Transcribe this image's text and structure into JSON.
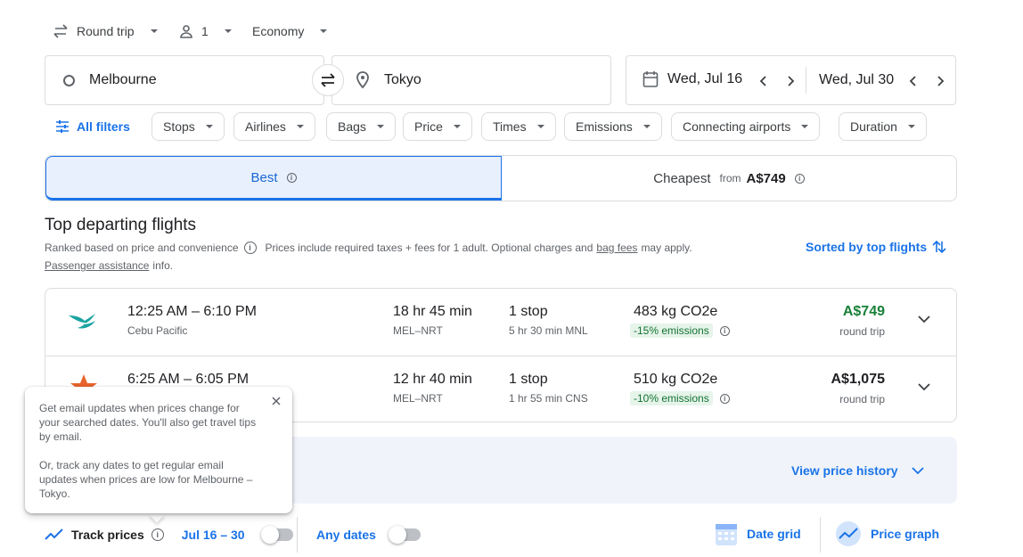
{
  "search": {
    "trip_type": "Round trip",
    "passengers": "1",
    "cabin": "Economy",
    "origin": "Melbourne",
    "destination": "Tokyo",
    "depart_date": "Wed, Jul 16",
    "return_date": "Wed, Jul 30"
  },
  "filters": {
    "all_filters": "All filters",
    "chips": [
      "Stops",
      "Airlines",
      "Bags",
      "Price",
      "Times",
      "Emissions",
      "Connecting airports",
      "Duration"
    ]
  },
  "tabs": {
    "best": "Best",
    "cheapest": "Cheapest",
    "cheapest_from": "from",
    "cheapest_price": "A$749"
  },
  "section": {
    "title": "Top departing flights",
    "ranked": "Ranked based on price and convenience",
    "prices_note": "Prices include required taxes + fees for 1 adult. Optional charges and",
    "bag_fees": "bag fees",
    "may_apply": "may apply.",
    "passenger_assistance": "Passenger assistance",
    "info": "info.",
    "sorted": "Sorted by top flights"
  },
  "flights": [
    {
      "times": "12:25 AM – 6:10 PM",
      "airline": "Cebu Pacific",
      "duration": "18 hr 45 min",
      "route": "MEL–NRT",
      "stops": "1 stop",
      "layover": "5 hr 30 min MNL",
      "emissions": "483 kg CO2e",
      "emissions_badge": "-15% emissions",
      "price": "A$749",
      "price_type": "round trip",
      "price_color": "#188038"
    },
    {
      "times": "6:25 AM – 6:05 PM",
      "airline": "",
      "duration": "12 hr 40 min",
      "route": "MEL–NRT",
      "stops": "1 stop",
      "layover": "1 hr 55 min CNS",
      "emissions": "510 kg CO2e",
      "emissions_badge": "-10% emissions",
      "price": "A$1,075",
      "price_type": "round trip",
      "price_color": "#202124"
    }
  ],
  "history": {
    "view_label": "View price history"
  },
  "tooltip": {
    "text1": "Get email updates when prices change for your searched dates. You'll also get travel tips by email.",
    "text2": "Or, track any dates to get regular email updates when prices are low for Melbourne – Tokyo."
  },
  "bottom": {
    "track_prices": "Track prices",
    "date_range": "Jul 16 – 30",
    "any_dates": "Any dates",
    "date_grid": "Date grid",
    "price_graph": "Price graph"
  },
  "colors": {
    "accent": "#1a73e8",
    "green": "#188038"
  }
}
